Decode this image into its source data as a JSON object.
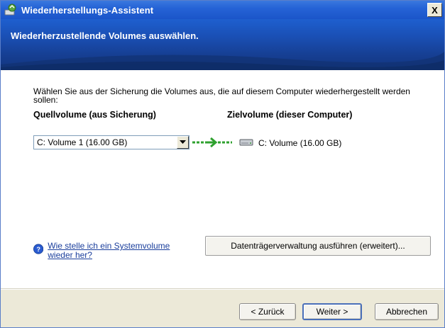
{
  "window": {
    "title": "Wiederherstellungs-Assistent",
    "close_label": "X"
  },
  "banner": {
    "title": "Wiederherzustellende Volumes auswählen."
  },
  "content": {
    "description": "Wählen Sie aus der Sicherung die Volumes aus, die auf diesem Computer wiederhergestellt werden sollen:",
    "source_header": "Quellvolume (aus Sicherung)",
    "destination_header": "Zielvolume (dieser Computer)",
    "source_select_value": "C: Volume 1 (16.00 GB)",
    "destination_label": "C: Volume (16.00 GB)",
    "help_link": "Wie stelle ich ein Systemvolume wieder her?",
    "disk_management_button": "Datenträgerverwaltung ausführen (erweitert)..."
  },
  "footer": {
    "back_button": "< Zurück",
    "next_button": "Weiter >",
    "cancel_button": "Abbrechen"
  },
  "colors": {
    "title_bar": "#2563d6",
    "banner": "#163f93",
    "window_face": "#ece9d8",
    "link": "#1a3e9c",
    "arrow": "#2fa12f"
  },
  "icons": {
    "title": "backup-wizard-icon",
    "arrow": "green-arrow-icon",
    "drive": "hard-drive-icon",
    "help": "help-icon"
  }
}
